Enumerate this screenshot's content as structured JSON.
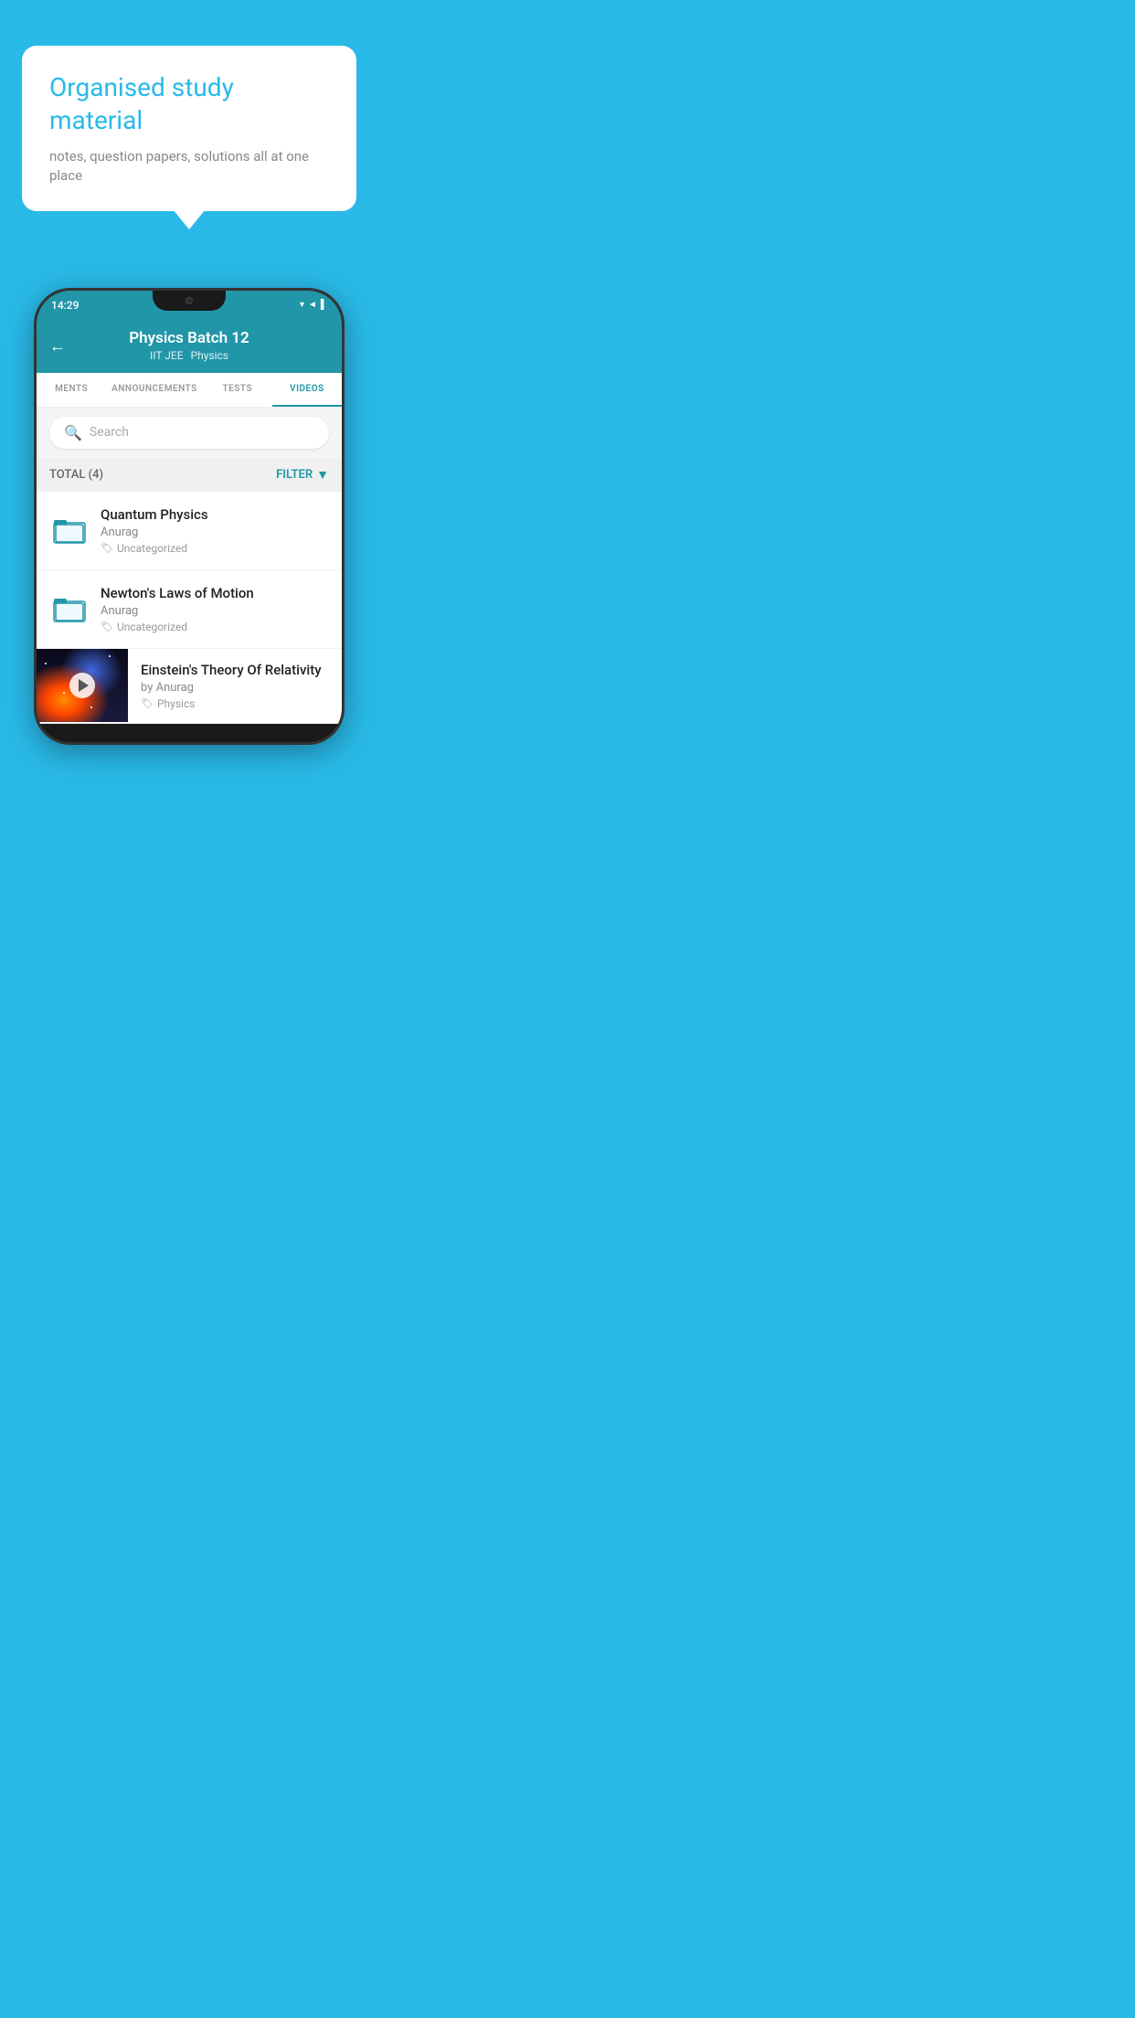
{
  "background_color": "#29B9E7",
  "bubble": {
    "title": "Organised study material",
    "subtitle": "notes, question papers, solutions all at one place"
  },
  "phone": {
    "status_bar": {
      "time": "14:29",
      "icons": "▼◄▌"
    },
    "header": {
      "title": "Physics Batch 12",
      "subtitle1": "IIT JEE",
      "subtitle2": "Physics",
      "back_label": "←"
    },
    "tabs": [
      {
        "label": "MENTS",
        "active": false
      },
      {
        "label": "ANNOUNCEMENTS",
        "active": false
      },
      {
        "label": "TESTS",
        "active": false
      },
      {
        "label": "VIDEOS",
        "active": true
      }
    ],
    "search": {
      "placeholder": "Search"
    },
    "filter_bar": {
      "total_label": "TOTAL (4)",
      "filter_label": "FILTER"
    },
    "videos": [
      {
        "title": "Quantum Physics",
        "author": "Anurag",
        "tag": "Uncategorized",
        "has_thumb": false
      },
      {
        "title": "Newton's Laws of Motion",
        "author": "Anurag",
        "tag": "Uncategorized",
        "has_thumb": false
      },
      {
        "title": "Einstein's Theory Of Relativity",
        "author": "by Anurag",
        "tag": "Physics",
        "has_thumb": true
      }
    ]
  }
}
